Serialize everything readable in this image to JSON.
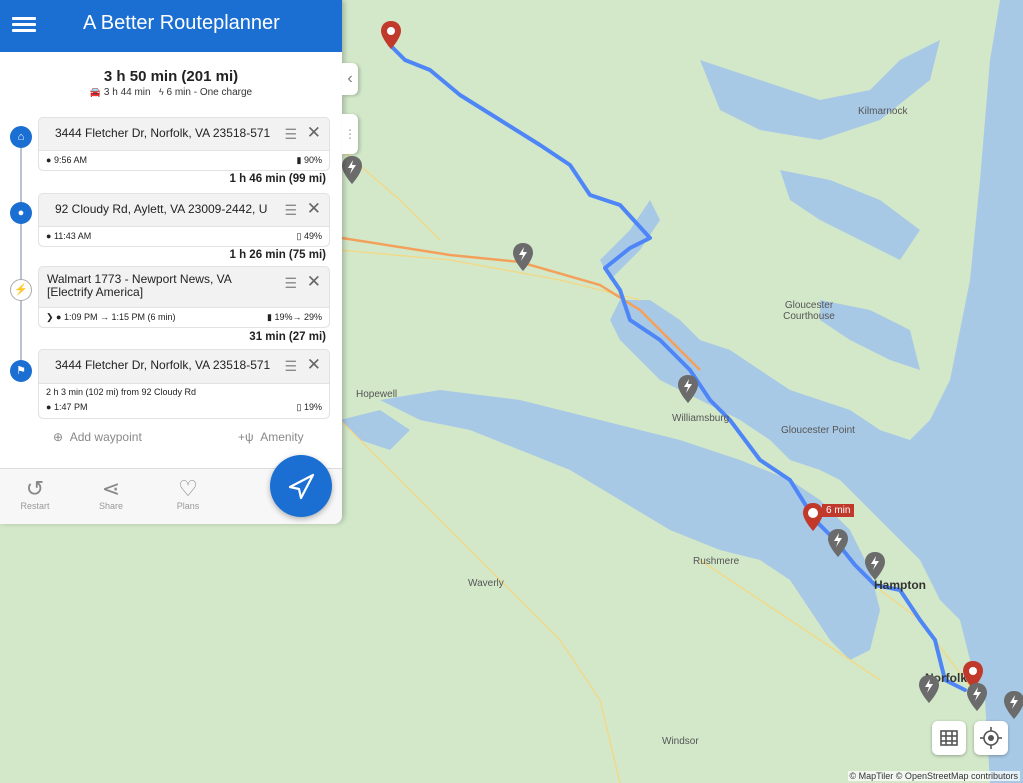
{
  "app": {
    "title": "A Better Routeplanner"
  },
  "summary": {
    "total": "3 h 50 min (201 mi)",
    "drive": "3 h 44 min",
    "charge": "6 min - One charge"
  },
  "stops": [
    {
      "address": "3444 Fletcher Dr, Norfolk, VA 23518-571",
      "time": "9:56 AM",
      "soc": "90%",
      "icon": "home-icon"
    },
    {
      "address": "92 Cloudy Rd, Aylett, VA 23009-2442, U",
      "time": "11:43 AM",
      "soc": "49%",
      "icon": "location-pin-icon"
    },
    {
      "address": "Walmart 1773 - Newport News, VA [Electrify America]",
      "time": "1:09 PM → 1:15 PM (6 min)",
      "soc": "19%→ 29%",
      "icon": "charger-icon"
    },
    {
      "address": "3444 Fletcher Dr, Norfolk, VA 23518-571",
      "note": "2 h 3 min (102 mi) from 92 Cloudy Rd",
      "time": "1:47 PM",
      "soc": "19%",
      "icon": "flag-icon"
    }
  ],
  "legs": [
    "1 h 46 min (99 mi)",
    "1 h 26 min (75 mi)",
    "31 min (27 mi)"
  ],
  "actions": {
    "add_waypoint": "Add waypoint",
    "amenity": "Amenity"
  },
  "toolbar": {
    "restart": "Restart",
    "share": "Share",
    "plans": "Plans"
  },
  "map": {
    "labels": [
      "Kilmarnock",
      "Gloucester Courthouse",
      "Hopewell",
      "Williamsburg",
      "Gloucester Point",
      "Rushmere",
      "Waverly",
      "Hampton",
      "Norfolk",
      "Windsor"
    ],
    "charge_badge": "6 min",
    "attribution": "© MapTiler © OpenStreetMap contributors"
  },
  "colors": {
    "brand": "#1b6fd2",
    "route": "#4f86f7",
    "water": "#a8c9e6",
    "land": "#cfe7c6"
  }
}
